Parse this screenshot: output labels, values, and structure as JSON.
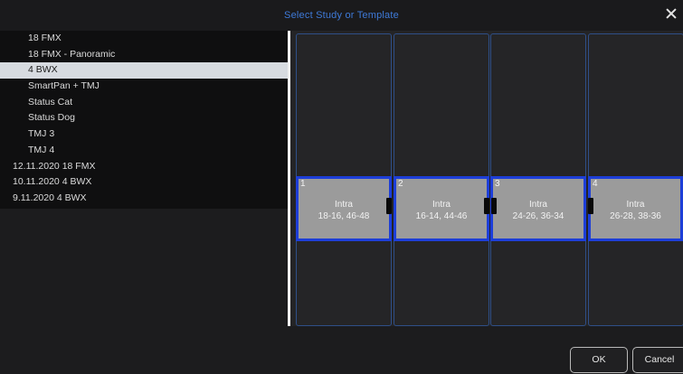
{
  "dialog": {
    "title": "Select Study or Template"
  },
  "list": {
    "items": [
      {
        "label": "18 FMX",
        "indent": "child",
        "selected": false
      },
      {
        "label": "18 FMX - Panoramic",
        "indent": "child",
        "selected": false
      },
      {
        "label": "4 BWX",
        "indent": "child",
        "selected": true
      },
      {
        "label": "SmartPan + TMJ",
        "indent": "child",
        "selected": false
      },
      {
        "label": "Status Cat",
        "indent": "child",
        "selected": false
      },
      {
        "label": "Status Dog",
        "indent": "child",
        "selected": false
      },
      {
        "label": "TMJ 3",
        "indent": "child",
        "selected": false
      },
      {
        "label": "TMJ 4",
        "indent": "child",
        "selected": false
      },
      {
        "label": "12.11.2020  18 FMX",
        "indent": "root",
        "selected": false
      },
      {
        "label": "10.11.2020  4 BWX",
        "indent": "root",
        "selected": false
      },
      {
        "label": "9.11.2020  4 BWX",
        "indent": "root",
        "selected": false
      }
    ]
  },
  "preview": {
    "tiles": [
      {
        "number": "1",
        "label": "Intra",
        "range": "18-16, 46-48"
      },
      {
        "number": "2",
        "label": "Intra",
        "range": "16-14, 44-46"
      },
      {
        "number": "3",
        "label": "Intra",
        "range": "24-26, 36-34"
      },
      {
        "number": "4",
        "label": "Intra",
        "range": "26-28, 38-36"
      }
    ]
  },
  "buttons": {
    "ok": "OK",
    "cancel": "Cancel"
  },
  "colors": {
    "title": "#3e7ad8",
    "tile_border": "#1d3ed8",
    "column_border": "#2f4f88",
    "selection": "#d7dbe0"
  }
}
